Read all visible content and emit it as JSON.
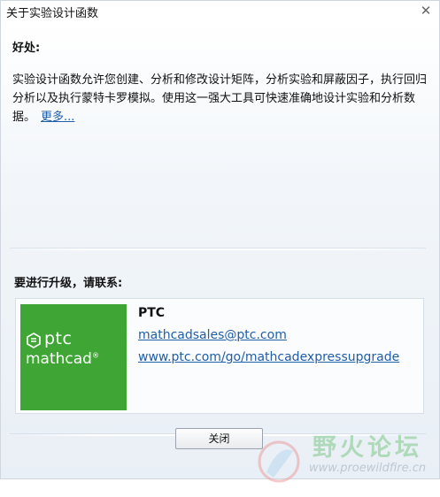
{
  "window": {
    "title": "关于实验设计函数",
    "close_glyph": "✕"
  },
  "benefits": {
    "heading": "好处:",
    "description": "实验设计函数允许您创建、分析和修改设计矩阵，分析实验和屏蔽因子，执行回归分析以及执行蒙特卡罗模拟。使用这一强大工具可快速准确地设计实验和分析数据。",
    "more_link": "更多..."
  },
  "upgrade": {
    "heading": "要进行升级，请联系:",
    "logo": {
      "brand": "ptc",
      "product": "mathcad",
      "reg": "®",
      "icon": "ptc-mathcad-logo-icon",
      "color": "#3fa535"
    },
    "company": "PTC",
    "email": "mathcadsales@ptc.com",
    "url": "www.ptc.com/go/mathcadexpressupgrade"
  },
  "footer": {
    "close_button": "关闭"
  },
  "watermark": {
    "text": "野火论坛",
    "url": "www.proewildfire.cn"
  },
  "colors": {
    "link": "#1f5ea8",
    "logo_green": "#3fa535"
  }
}
